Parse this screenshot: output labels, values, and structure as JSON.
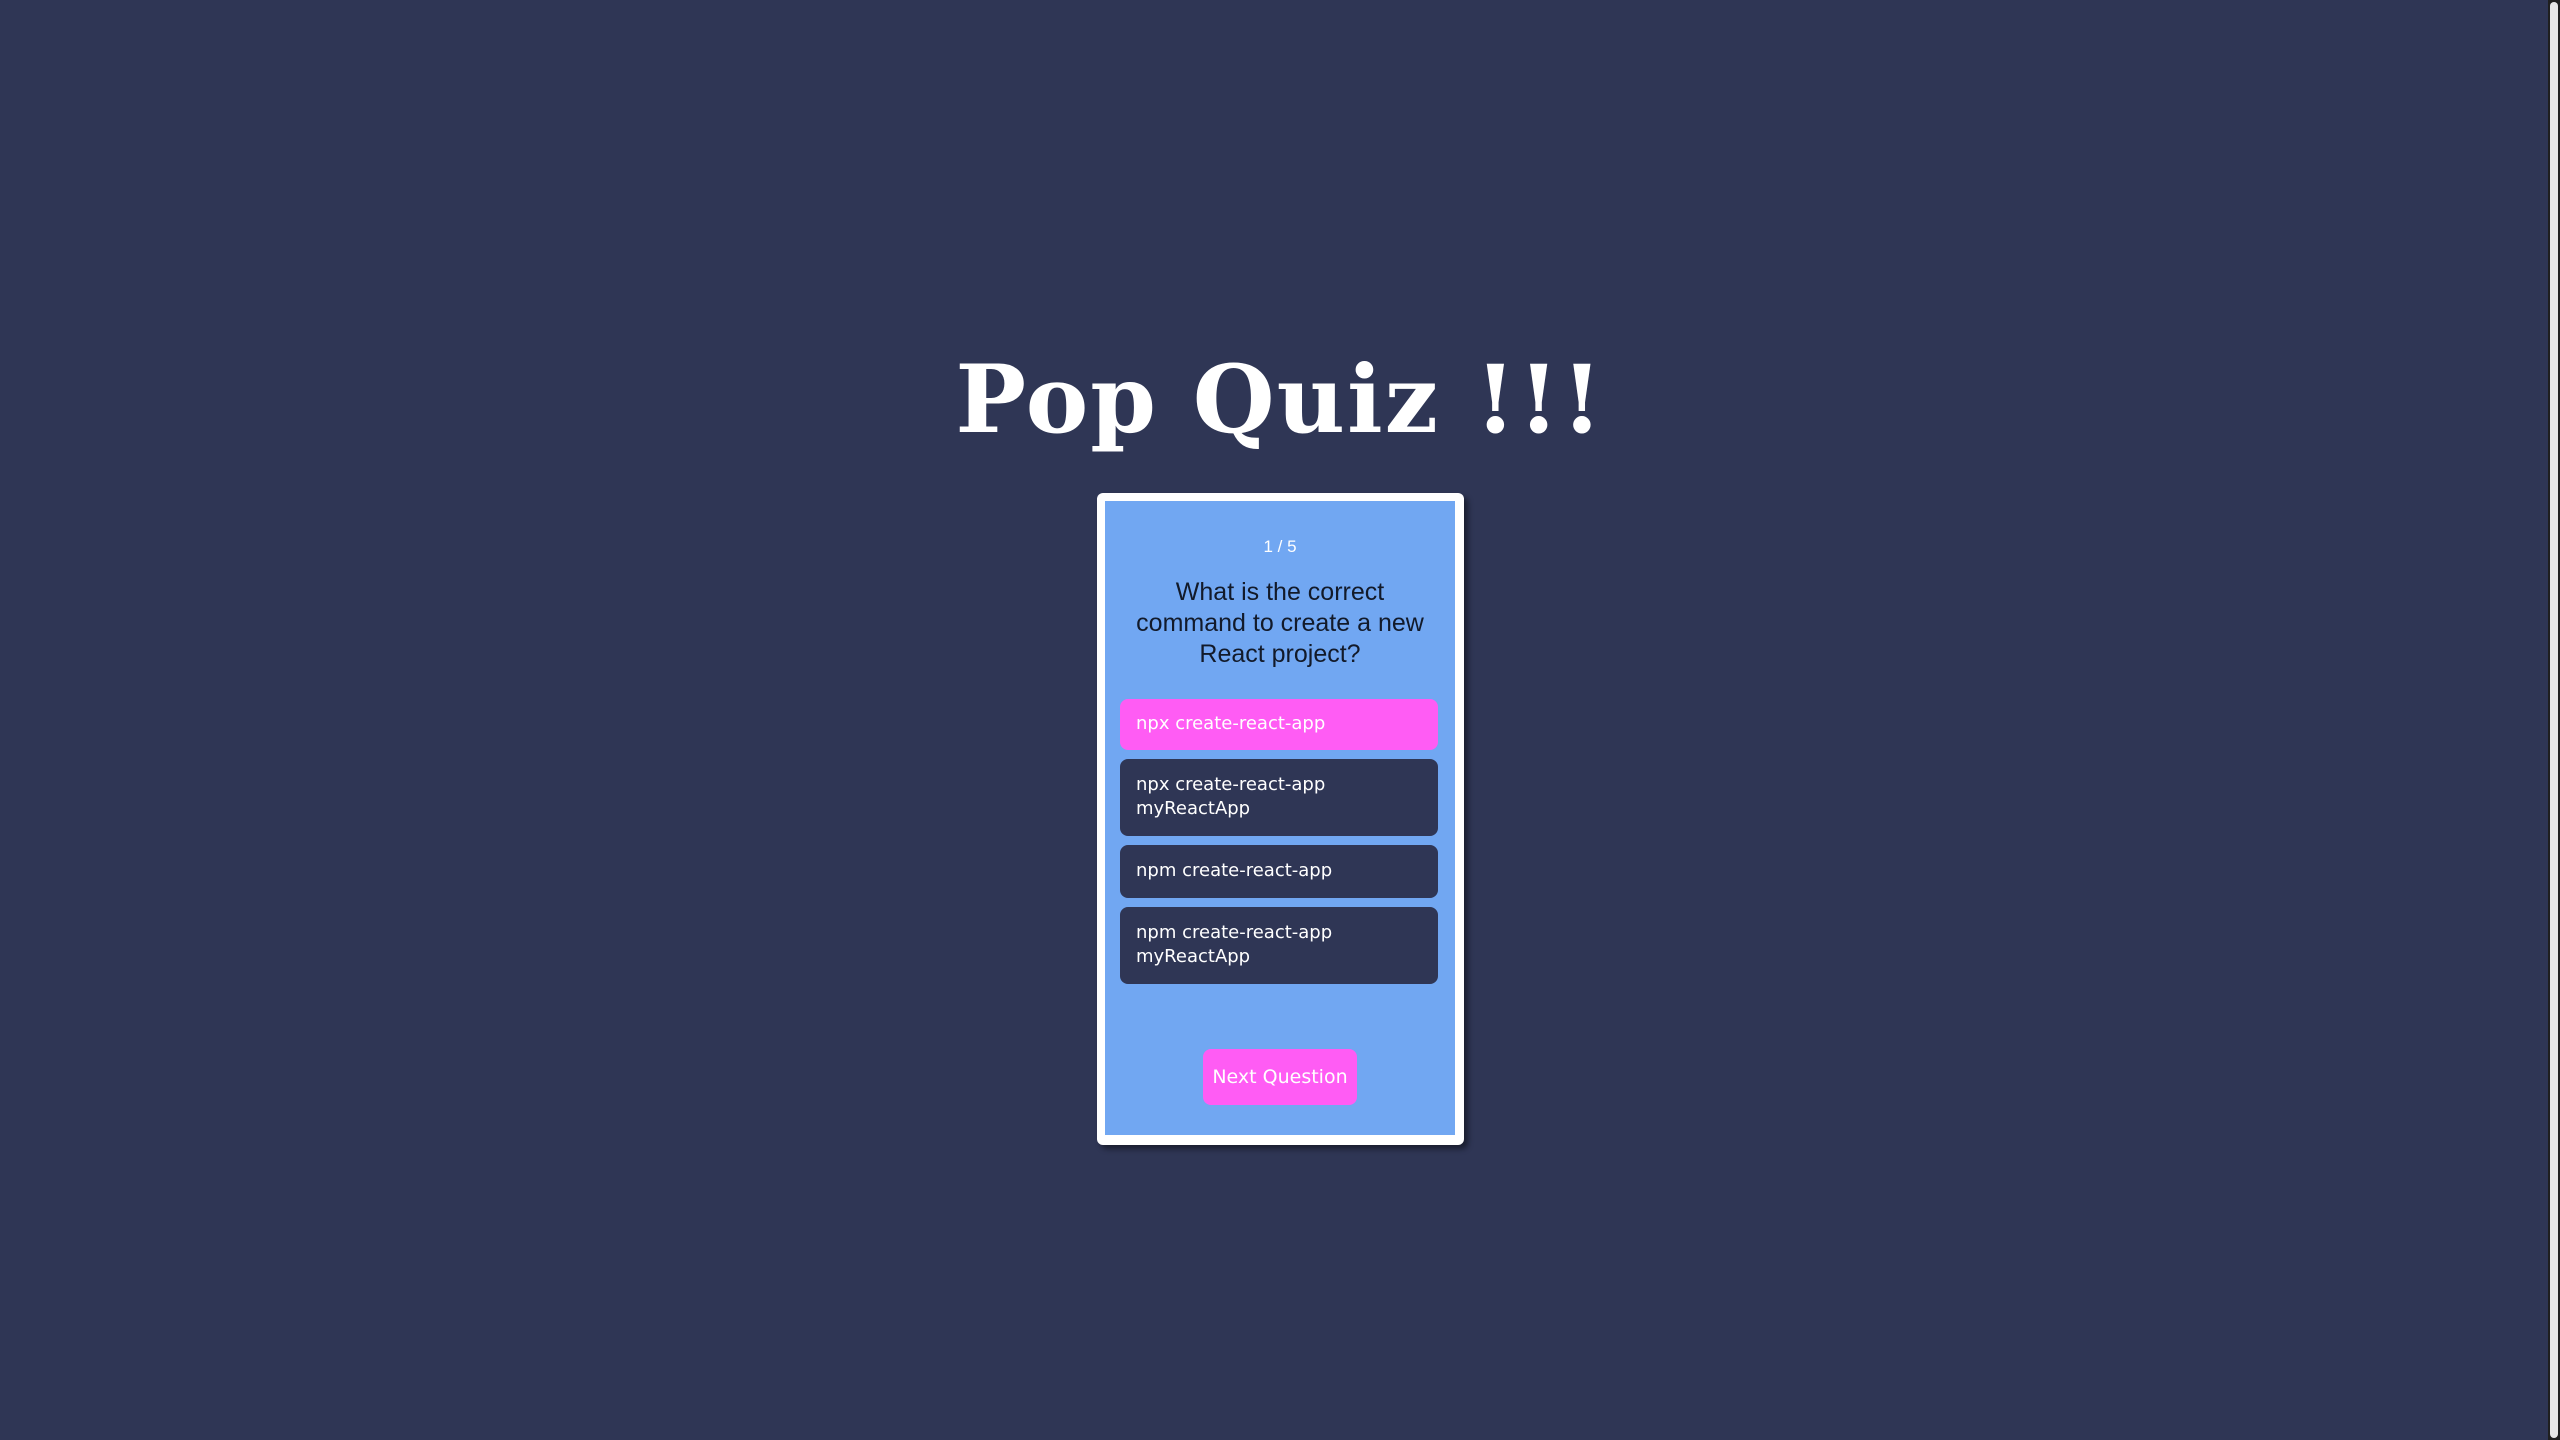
{
  "page": {
    "title": "Pop Quiz !!!"
  },
  "quiz": {
    "counter": "1 / 5",
    "question": "What is the correct command to create a new React project?",
    "answers": [
      {
        "label": "npx create-react-app",
        "selected": true
      },
      {
        "label": "npx create-react-app myReactApp",
        "selected": false
      },
      {
        "label": "npm create-react-app",
        "selected": false
      },
      {
        "label": "npm create-react-app myReactApp",
        "selected": false
      }
    ],
    "next_label": "Next Question"
  },
  "colors": {
    "background": "#2f3655",
    "card": "#71a7f2",
    "accent": "#ff5cf4",
    "answer_default": "#2f3655"
  }
}
